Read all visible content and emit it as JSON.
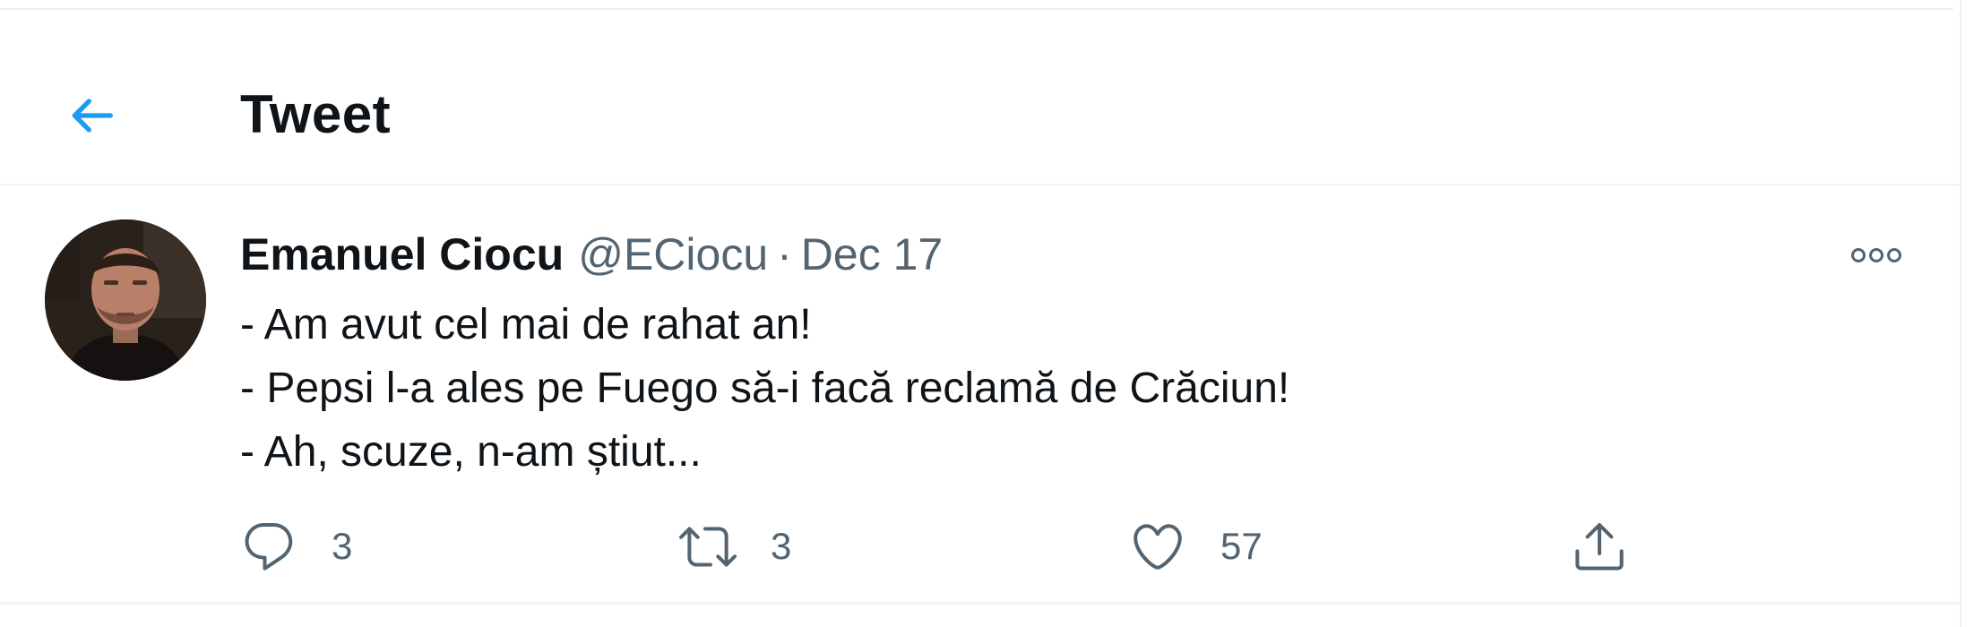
{
  "header": {
    "title": "Tweet"
  },
  "tweet": {
    "author_name": "Emanuel Ciocu",
    "author_handle": "@ECiocu",
    "separator": "·",
    "date": "Dec 17",
    "lines": [
      "- Am avut cel mai de rahat an!",
      "- Pepsi l-a ales pe Fuego să-i facă reclamă de Crăciun!",
      "- Ah, scuze, n-am știut..."
    ],
    "counts": {
      "replies": "3",
      "retweets": "3",
      "likes": "57"
    }
  },
  "colors": {
    "accent": "#1d9bf0",
    "text": "#0f1419",
    "secondary": "#536471",
    "divider": "#eff3f4"
  },
  "icons": {
    "back": "arrow-left-icon",
    "more": "more-dots-icon",
    "reply": "reply-icon",
    "retweet": "retweet-icon",
    "like": "heart-icon",
    "share": "share-icon"
  }
}
